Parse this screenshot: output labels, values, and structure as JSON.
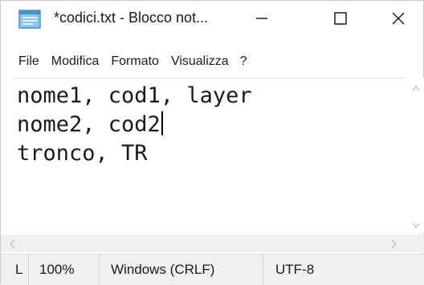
{
  "window": {
    "title": "*codici.txt - Blocco not...",
    "controls": {
      "minimize": "—",
      "maximize": "☐",
      "close": "✕"
    }
  },
  "menubar": {
    "items": [
      "File",
      "Modifica",
      "Formato",
      "Visualizza",
      "?"
    ]
  },
  "editor": {
    "lines": [
      "nome1, cod1, layer",
      "nome2, cod2",
      "tronco, TR"
    ]
  },
  "statusbar": {
    "position": "L",
    "zoom": "100%",
    "line_ending": "Windows (CRLF)",
    "encoding": "UTF-8"
  },
  "icons": {
    "app": "notepad-icon",
    "scroll_left": "chevron-left-icon",
    "scroll_right": "chevron-right-icon",
    "scroll_up": "chevron-up-icon",
    "scroll_down": "chevron-down-icon"
  }
}
